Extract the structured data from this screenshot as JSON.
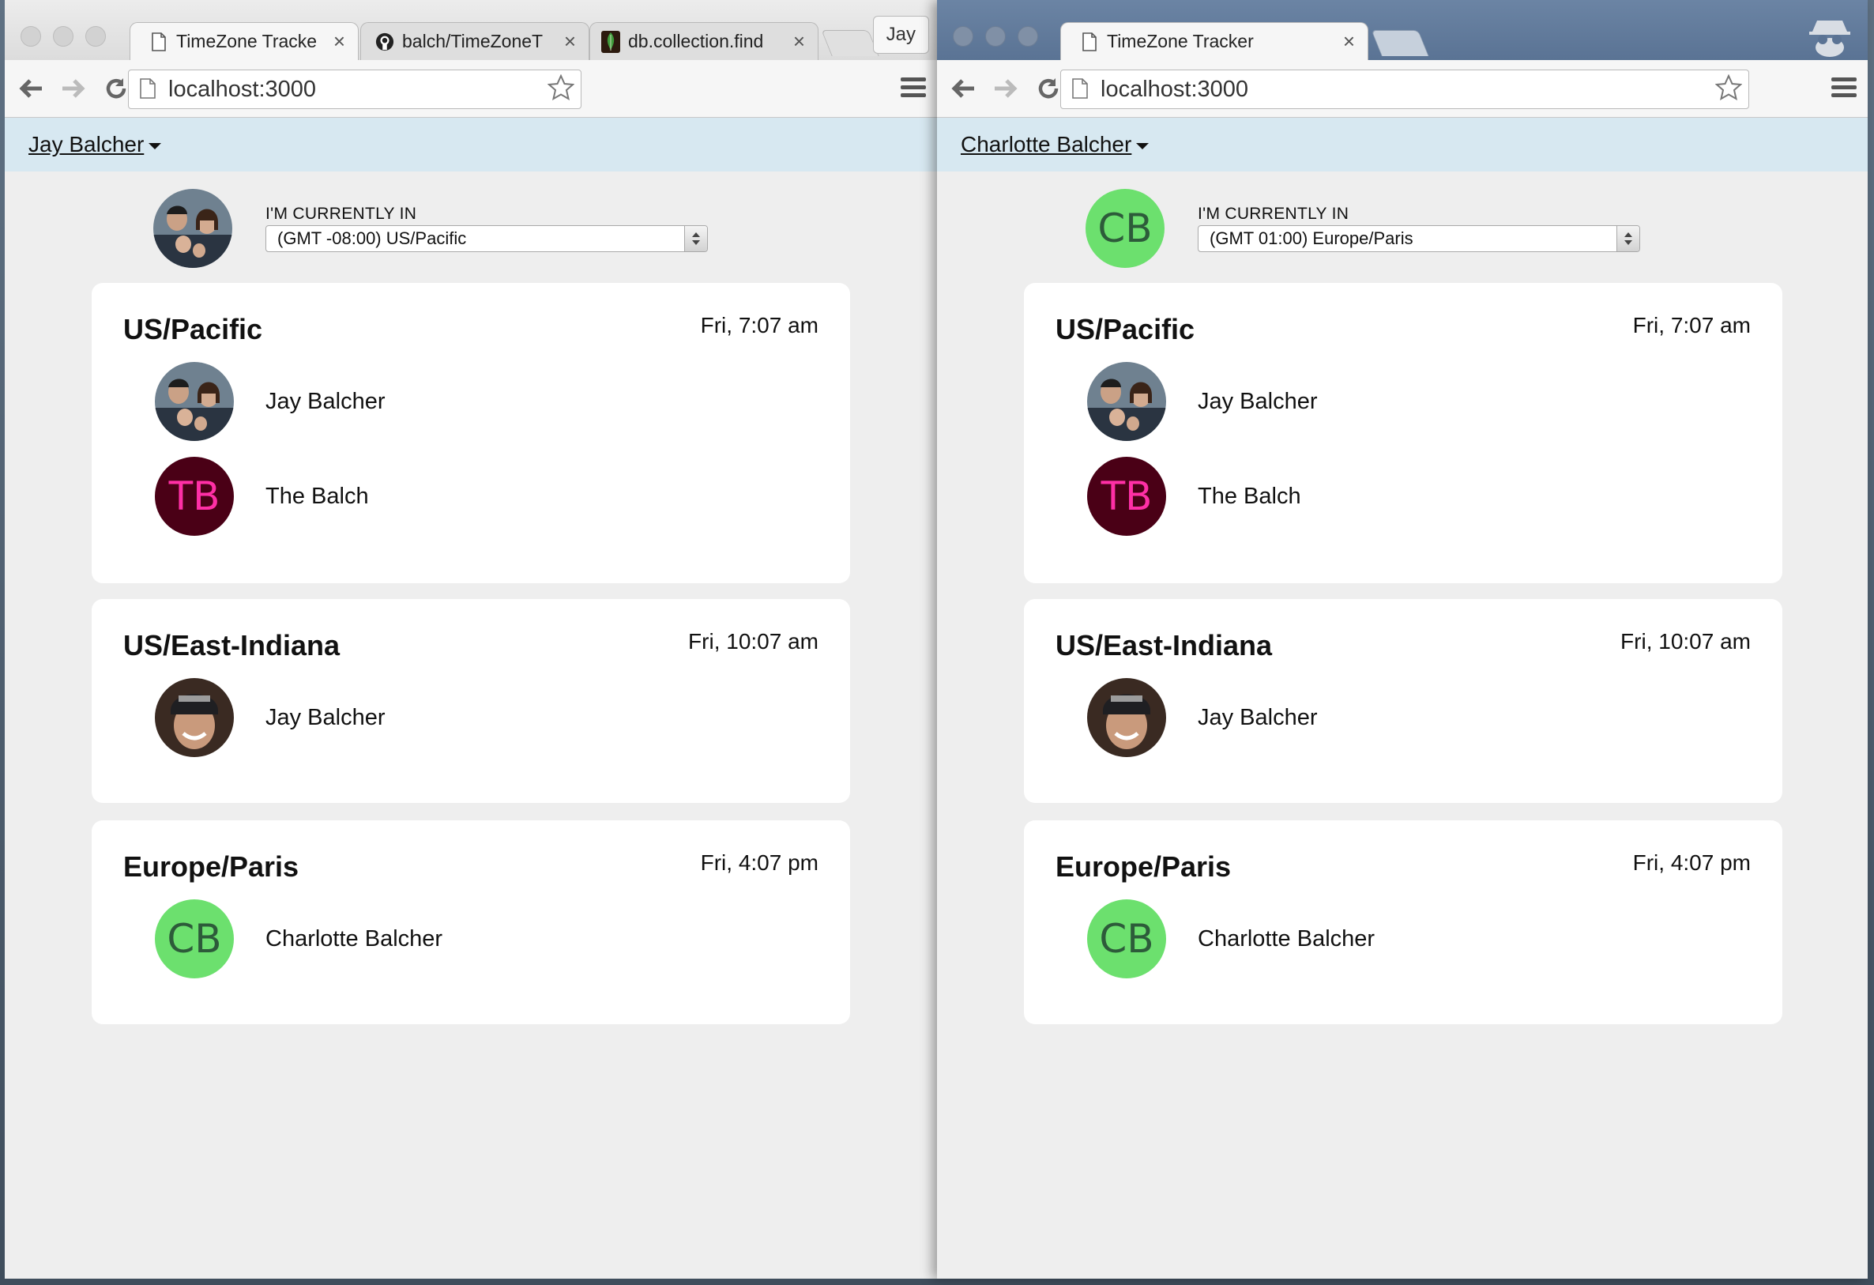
{
  "colors": {
    "user_bar": "#d7e8f1",
    "avatar_cb_bg": "#6ce06e",
    "avatar_cb_text": "#2d5b3a",
    "avatar_tb_bg": "#4a0016",
    "avatar_tb_text": "#ff2fa6"
  },
  "left": {
    "tabs": [
      {
        "title": "TimeZone Tracke",
        "icon": "page-icon"
      },
      {
        "title": "balch/TimeZoneT",
        "icon": "github-icon"
      },
      {
        "title": "db.collection.find",
        "icon": "mongodb-leaf-icon"
      }
    ],
    "profile": "Jay",
    "url": "localhost:3000",
    "user_menu": "Jay Balcher",
    "location_label": "I'M CURRENTLY IN",
    "timezone": "(GMT -08:00) US/Pacific",
    "groups": [
      {
        "zone": "US/Pacific",
        "time": "Fri, 7:07 am",
        "members": [
          {
            "name": "Jay Balcher",
            "avatar": "photo-family"
          },
          {
            "name": "The Balch",
            "initials": "TB"
          }
        ]
      },
      {
        "zone": "US/East-Indiana",
        "time": "Fri, 10:07 am",
        "members": [
          {
            "name": "Jay Balcher",
            "avatar": "photo-man-cap"
          }
        ]
      },
      {
        "zone": "Europe/Paris",
        "time": "Fri, 4:07 pm",
        "members": [
          {
            "name": "Charlotte Balcher",
            "initials": "CB"
          }
        ]
      }
    ]
  },
  "right": {
    "tabs": [
      {
        "title": "TimeZone Tracker",
        "icon": "page-icon"
      }
    ],
    "url": "localhost:3000",
    "user_menu": "Charlotte Balcher",
    "self_initials": "CB",
    "location_label": "I'M CURRENTLY IN",
    "timezone": "(GMT 01:00) Europe/Paris",
    "groups": [
      {
        "zone": "US/Pacific",
        "time": "Fri, 7:07 am",
        "members": [
          {
            "name": "Jay Balcher",
            "avatar": "photo-family"
          },
          {
            "name": "The Balch",
            "initials": "TB"
          }
        ]
      },
      {
        "zone": "US/East-Indiana",
        "time": "Fri, 10:07 am",
        "members": [
          {
            "name": "Jay Balcher",
            "avatar": "photo-man-cap"
          }
        ]
      },
      {
        "zone": "Europe/Paris",
        "time": "Fri, 4:07 pm",
        "members": [
          {
            "name": "Charlotte Balcher",
            "initials": "CB"
          }
        ]
      }
    ]
  }
}
